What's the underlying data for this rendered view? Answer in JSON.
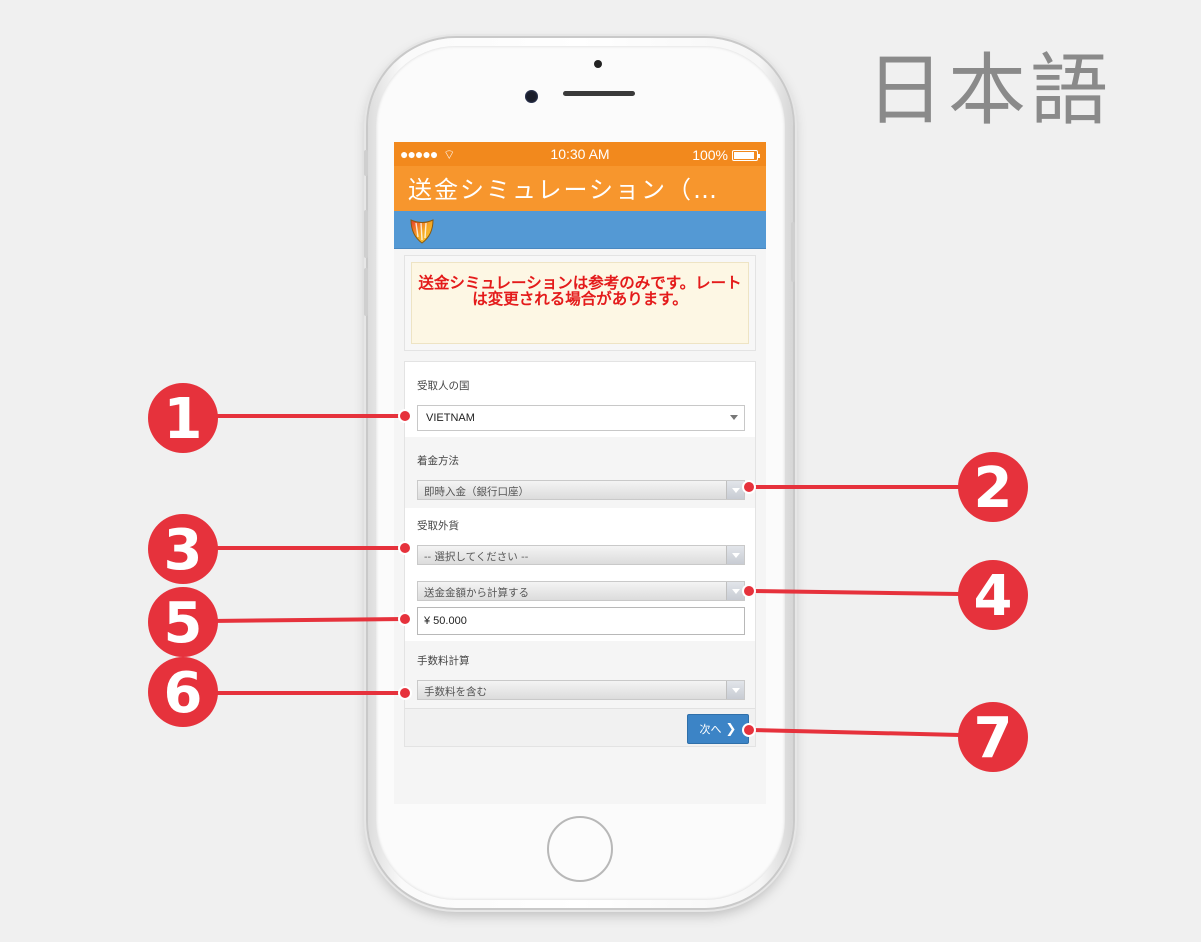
{
  "language_label": "日本語",
  "status_bar": {
    "carrier": "●●●●● ",
    "time": "10:30 AM",
    "battery": "100%"
  },
  "title_bar": {
    "title": "送金シミュレーション（…"
  },
  "notice": {
    "text": "送金シミュレーションは参考のみです。レートは変更される場合があります。"
  },
  "form": {
    "country": {
      "label": "受取人の国",
      "value": "VIETNAM"
    },
    "method": {
      "label": "着金方法",
      "value": "即時入金（銀行口座）"
    },
    "currency": {
      "label": "受取外貨",
      "value": "-- 選択してください --"
    },
    "calc_basis": {
      "value": "送金金額から計算する"
    },
    "amount": {
      "value": "¥ 50.000"
    },
    "fee": {
      "label": "手数料計算",
      "value": "手数料を含む"
    }
  },
  "next_button": {
    "label": "次へ",
    "icon": "chevron-right-icon"
  },
  "callouts": [
    "1",
    "2",
    "3",
    "4",
    "5",
    "6",
    "7"
  ],
  "colors": {
    "orange_status": "#f2891d",
    "orange_title": "#f7962d",
    "blue_bar": "#5499d4",
    "callout_red": "#e6323c",
    "notice_red": "#e41b1b"
  }
}
